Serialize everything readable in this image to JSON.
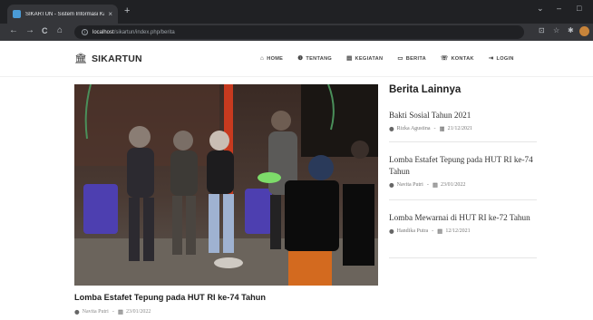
{
  "browser": {
    "tab_title": "SIKARTUN - Sistem Informasi Ka",
    "tab_close": "×",
    "new_tab": "+",
    "url_host": "localhost",
    "url_path": "/sikartun/index.php/berita",
    "info_glyph": "i",
    "nav": {
      "back": "←",
      "forward": "→",
      "reload": "C",
      "home": "⌂"
    },
    "window": {
      "minimize": "⌄",
      "restore": "–",
      "close": "□"
    },
    "toolbar_icons": {
      "share": "⊡",
      "star": "☆",
      "extensions": "✱"
    }
  },
  "site": {
    "brand_icon": "🏛",
    "brand": "SIKARTUN",
    "menu": [
      {
        "icon": "⌂",
        "label": "HOME"
      },
      {
        "icon": "❶",
        "label": "TENTANG"
      },
      {
        "icon": "▤",
        "label": "KEGIATAN"
      },
      {
        "icon": "▭",
        "label": "BERITA"
      },
      {
        "icon": "☏",
        "label": "KONTAK"
      },
      {
        "icon": "⇥",
        "label": "LOGIN"
      }
    ]
  },
  "article": {
    "title": "Lomba Estafet Tepung pada HUT RI ke-74 Tahun",
    "author_icon": "●",
    "author": "Navita Putri",
    "separator": "-",
    "date_icon": "▦",
    "date": "23/01/2022"
  },
  "sidebar": {
    "title": "Berita Lainnya",
    "items": [
      {
        "title": "Bakti Sosial Tahun 2021",
        "author": "Rizka Agustina",
        "date": "21/12/2021"
      },
      {
        "title": "Lomba Estafet Tepung pada HUT RI ke-74 Tahun",
        "author": "Navita Putri",
        "date": "23/01/2022"
      },
      {
        "title": "Lomba Mewarnai di HUT RI ke-72 Tahun",
        "author": "Handika Putra",
        "date": "12/12/2021"
      }
    ]
  },
  "colors": {
    "chrome_dark": "#202124",
    "chrome_mid": "#35363a",
    "text_dark": "#1e1e1e"
  }
}
